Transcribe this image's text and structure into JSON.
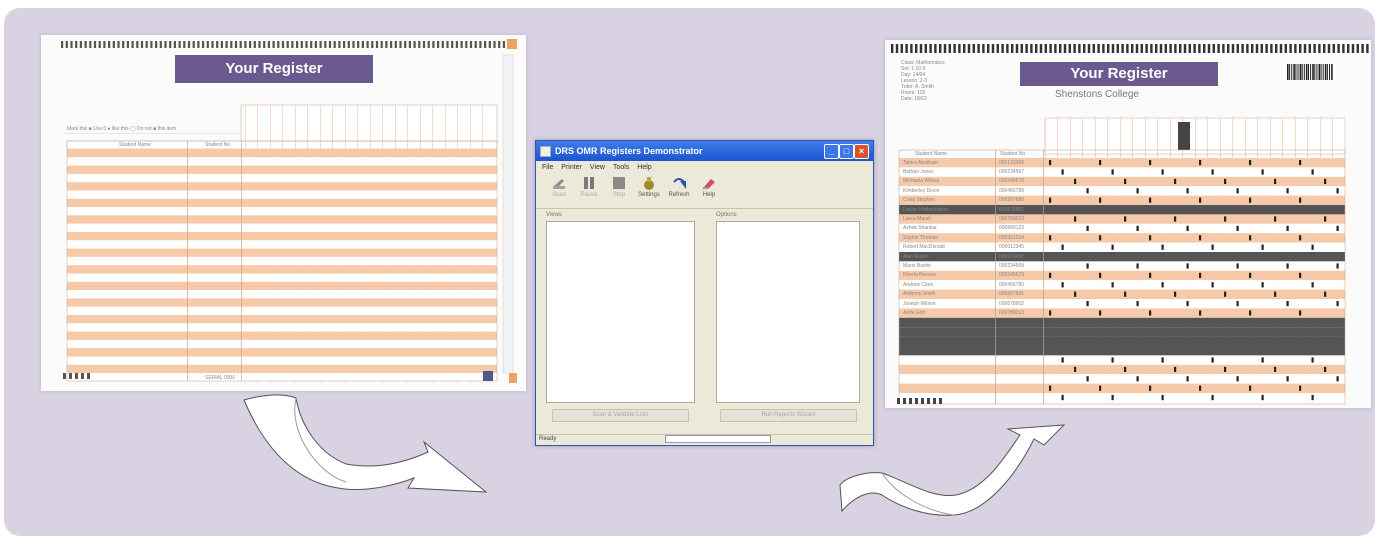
{
  "left_document": {
    "banner": "Your Register",
    "code_line": "Mark this ■ Use 0 ● like this ◯ Do not ■ this item",
    "col_headers": [
      "Student Name",
      "Student No."
    ],
    "footer": "SERIAL 0000"
  },
  "right_document": {
    "banner": "Your Register",
    "college": "Shenstons College",
    "meta_lines": [
      "Class: Mathematics",
      "Set: 1 10 8",
      "Day: 14/04",
      "Lesson: 2-3",
      "Tutor: A. Smith",
      "Room: 102",
      "Date: 18/02"
    ],
    "col_headers": [
      "Student Name",
      "Student No."
    ],
    "students": [
      {
        "name": "Tahiru Abraham",
        "no": "000123456"
      },
      {
        "name": "Bethan Jones",
        "no": "000234567"
      },
      {
        "name": "Michaela Wilkes",
        "no": "000345678"
      },
      {
        "name": "Kimberley Dixon",
        "no": "000456789"
      },
      {
        "name": "Craig Stephen",
        "no": "000567890"
      },
      {
        "name": "Louise Hetherington",
        "no": "000678901"
      },
      {
        "name": "Laura Marsh",
        "no": "000789012"
      },
      {
        "name": "Ashok Shankar",
        "no": "000890123"
      },
      {
        "name": "Sophie Thomas",
        "no": "000901234"
      },
      {
        "name": "Robert MacDonald",
        "no": "000012345"
      },
      {
        "name": "Alan Maher",
        "no": "000123457"
      },
      {
        "name": "Marie Bashir",
        "no": "000234568"
      },
      {
        "name": "Rhoda Benson",
        "no": "000345679"
      },
      {
        "name": "Andrew Clark",
        "no": "000456780"
      },
      {
        "name": "Anthony Smith",
        "no": "000567891"
      },
      {
        "name": "Joseph Wilson",
        "no": "000678902"
      },
      {
        "name": "Aoife Goh",
        "no": "000789013"
      }
    ]
  },
  "app_window": {
    "title": "DRS OMR Registers Demonstrator",
    "menu": [
      "File",
      "Printer",
      "View",
      "Tools",
      "Help"
    ],
    "tools": [
      {
        "label": "Scan",
        "icon": "scanner-icon",
        "enabled": false
      },
      {
        "label": "Pause",
        "icon": "pause-icon",
        "enabled": false
      },
      {
        "label": "Stop",
        "icon": "stop-icon",
        "enabled": false
      },
      {
        "label": "Settings",
        "icon": "settings-icon",
        "enabled": true
      },
      {
        "label": "Refresh",
        "icon": "refresh-icon",
        "enabled": true
      },
      {
        "label": "Help",
        "icon": "help-icon",
        "enabled": true
      }
    ],
    "left_panel_label": "Views",
    "right_panel_label": "Options",
    "right_list_item": "",
    "left_button": "Scan & Validate Lists",
    "right_button": "Run Reports Wizard",
    "status_text": "Ready"
  },
  "colors": {
    "banner": "#6b5a8f",
    "panel": "#d8d2e2",
    "grid_orange": "#f6c9a8",
    "xp_blue": "#1c55d0"
  }
}
